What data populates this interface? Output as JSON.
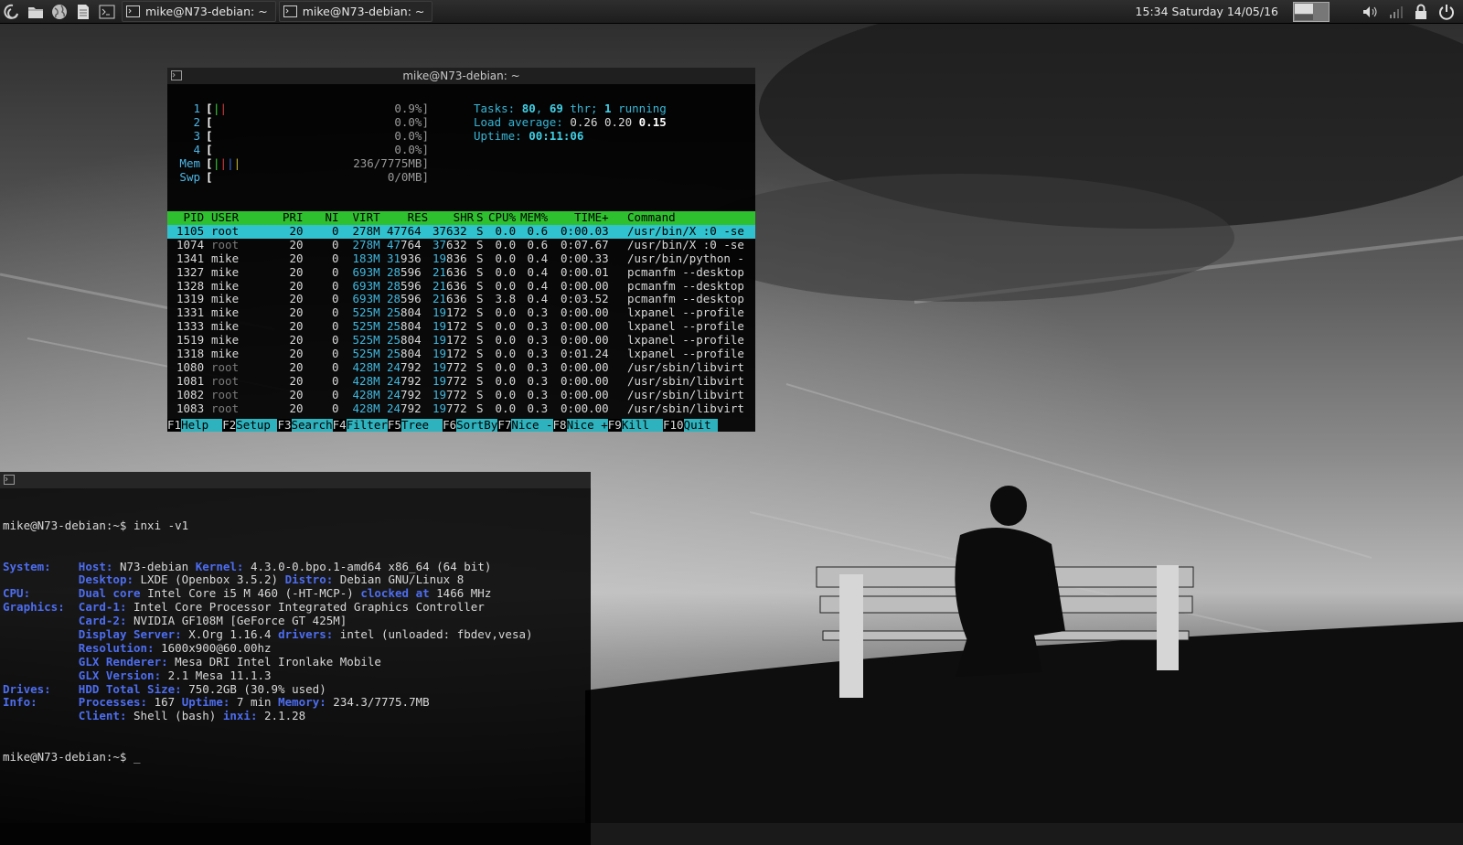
{
  "panel": {
    "tasks": [
      {
        "title": "mike@N73-debian: ~"
      },
      {
        "title": "mike@N73-debian: ~"
      }
    ],
    "clock": "15:34 Saturday 14/05/16"
  },
  "htop": {
    "title": "mike@N73-debian: ~",
    "meters": [
      {
        "label": "1",
        "value": "0.9%]",
        "bars": "||"
      },
      {
        "label": "2",
        "value": "0.0%]",
        "bars": ""
      },
      {
        "label": "3",
        "value": "0.0%]",
        "bars": ""
      },
      {
        "label": "4",
        "value": "0.0%]",
        "bars": ""
      },
      {
        "label": "Mem",
        "value": "236/7775MB]",
        "bars": "||||"
      },
      {
        "label": "Swp",
        "value": "0/0MB]",
        "bars": ""
      }
    ],
    "tasks": {
      "label": "Tasks:",
      "count": "80",
      "sep": ",",
      "threads": "69",
      "thr_label": "thr;",
      "running": "1",
      "running_label": "running"
    },
    "load": {
      "label": "Load average:",
      "a": "0.26",
      "b": "0.20",
      "c": "0.15"
    },
    "uptime": {
      "label": "Uptime:",
      "value": "00:11:06"
    },
    "columns": {
      "pid": "PID",
      "user": "USER",
      "pri": "PRI",
      "ni": "NI",
      "virt": "VIRT",
      "res": "RES",
      "shr": "SHR",
      "s": "S",
      "cpu": "CPU%",
      "mem": "MEM%",
      "time": "TIME+",
      "cmd": "Command"
    },
    "rows": [
      {
        "pid": "1105",
        "user": "root",
        "pri": "20",
        "ni": "0",
        "virt": "278M",
        "res_k": "47",
        "res": "764",
        "shr_k": "37",
        "shr": "632",
        "s": "S",
        "cpu": "0.0",
        "mem": "0.6",
        "time": "0:00.03",
        "cmd": "/usr/bin/X :0 -se"
      },
      {
        "pid": "1074",
        "user": "root",
        "pri": "20",
        "ni": "0",
        "virt": "278M",
        "res_k": "47",
        "res": "764",
        "shr_k": "37",
        "shr": "632",
        "s": "S",
        "cpu": "0.0",
        "mem": "0.6",
        "time": "0:07.67",
        "cmd": "/usr/bin/X :0 -se"
      },
      {
        "pid": "1341",
        "user": "mike",
        "pri": "20",
        "ni": "0",
        "virt": "183M",
        "res_k": "31",
        "res": "936",
        "shr_k": "19",
        "shr": "836",
        "s": "S",
        "cpu": "0.0",
        "mem": "0.4",
        "time": "0:00.33",
        "cmd": "/usr/bin/python -"
      },
      {
        "pid": "1327",
        "user": "mike",
        "pri": "20",
        "ni": "0",
        "virt": "693M",
        "res_k": "28",
        "res": "596",
        "shr_k": "21",
        "shr": "636",
        "s": "S",
        "cpu": "0.0",
        "mem": "0.4",
        "time": "0:00.01",
        "cmd": "pcmanfm --desktop"
      },
      {
        "pid": "1328",
        "user": "mike",
        "pri": "20",
        "ni": "0",
        "virt": "693M",
        "res_k": "28",
        "res": "596",
        "shr_k": "21",
        "shr": "636",
        "s": "S",
        "cpu": "0.0",
        "mem": "0.4",
        "time": "0:00.00",
        "cmd": "pcmanfm --desktop"
      },
      {
        "pid": "1319",
        "user": "mike",
        "pri": "20",
        "ni": "0",
        "virt": "693M",
        "res_k": "28",
        "res": "596",
        "shr_k": "21",
        "shr": "636",
        "s": "S",
        "cpu": "3.8",
        "mem": "0.4",
        "time": "0:03.52",
        "cmd": "pcmanfm --desktop"
      },
      {
        "pid": "1331",
        "user": "mike",
        "pri": "20",
        "ni": "0",
        "virt": "525M",
        "res_k": "25",
        "res": "804",
        "shr_k": "19",
        "shr": "172",
        "s": "S",
        "cpu": "0.0",
        "mem": "0.3",
        "time": "0:00.00",
        "cmd": "lxpanel --profile"
      },
      {
        "pid": "1333",
        "user": "mike",
        "pri": "20",
        "ni": "0",
        "virt": "525M",
        "res_k": "25",
        "res": "804",
        "shr_k": "19",
        "shr": "172",
        "s": "S",
        "cpu": "0.0",
        "mem": "0.3",
        "time": "0:00.00",
        "cmd": "lxpanel --profile"
      },
      {
        "pid": "1519",
        "user": "mike",
        "pri": "20",
        "ni": "0",
        "virt": "525M",
        "res_k": "25",
        "res": "804",
        "shr_k": "19",
        "shr": "172",
        "s": "S",
        "cpu": "0.0",
        "mem": "0.3",
        "time": "0:00.00",
        "cmd": "lxpanel --profile"
      },
      {
        "pid": "1318",
        "user": "mike",
        "pri": "20",
        "ni": "0",
        "virt": "525M",
        "res_k": "25",
        "res": "804",
        "shr_k": "19",
        "shr": "172",
        "s": "S",
        "cpu": "0.0",
        "mem": "0.3",
        "time": "0:01.24",
        "cmd": "lxpanel --profile"
      },
      {
        "pid": "1080",
        "user": "root",
        "pri": "20",
        "ni": "0",
        "virt": "428M",
        "res_k": "24",
        "res": "792",
        "shr_k": "19",
        "shr": "772",
        "s": "S",
        "cpu": "0.0",
        "mem": "0.3",
        "time": "0:00.00",
        "cmd": "/usr/sbin/libvirt"
      },
      {
        "pid": "1081",
        "user": "root",
        "pri": "20",
        "ni": "0",
        "virt": "428M",
        "res_k": "24",
        "res": "792",
        "shr_k": "19",
        "shr": "772",
        "s": "S",
        "cpu": "0.0",
        "mem": "0.3",
        "time": "0:00.00",
        "cmd": "/usr/sbin/libvirt"
      },
      {
        "pid": "1082",
        "user": "root",
        "pri": "20",
        "ni": "0",
        "virt": "428M",
        "res_k": "24",
        "res": "792",
        "shr_k": "19",
        "shr": "772",
        "s": "S",
        "cpu": "0.0",
        "mem": "0.3",
        "time": "0:00.00",
        "cmd": "/usr/sbin/libvirt"
      },
      {
        "pid": "1083",
        "user": "root",
        "pri": "20",
        "ni": "0",
        "virt": "428M",
        "res_k": "24",
        "res": "792",
        "shr_k": "19",
        "shr": "772",
        "s": "S",
        "cpu": "0.0",
        "mem": "0.3",
        "time": "0:00.00",
        "cmd": "/usr/sbin/libvirt"
      }
    ],
    "fkeys": [
      {
        "key": "F1",
        "label": "Help  "
      },
      {
        "key": "F2",
        "label": "Setup "
      },
      {
        "key": "F3",
        "label": "Search"
      },
      {
        "key": "F4",
        "label": "Filter"
      },
      {
        "key": "F5",
        "label": "Tree  "
      },
      {
        "key": "F6",
        "label": "SortBy"
      },
      {
        "key": "F7",
        "label": "Nice -"
      },
      {
        "key": "F8",
        "label": "Nice +"
      },
      {
        "key": "F9",
        "label": "Kill  "
      },
      {
        "key": "F10",
        "label": "Quit "
      }
    ]
  },
  "inxi": {
    "prompt1": "mike@N73-debian:~$ inxi -v1",
    "prompt2": "mike@N73-debian:~$ _",
    "lines": [
      [
        {
          "k": "System:    "
        },
        {
          "k": "Host: "
        },
        {
          "v": "N73-debian "
        },
        {
          "k": "Kernel: "
        },
        {
          "v": "4.3.0-0.bpo.1-amd64 x86_64 (64 bit)"
        }
      ],
      [
        {
          "v": "           "
        },
        {
          "k": "Desktop: "
        },
        {
          "v": "LXDE (Openbox 3.5.2) "
        },
        {
          "k": "Distro: "
        },
        {
          "v": "Debian GNU/Linux 8"
        }
      ],
      [
        {
          "k": "CPU:       "
        },
        {
          "k": "Dual core "
        },
        {
          "v": "Intel Core i5 M 460 (-HT-MCP-) "
        },
        {
          "k": "clocked at "
        },
        {
          "v": "1466 MHz"
        }
      ],
      [
        {
          "k": "Graphics:  "
        },
        {
          "k": "Card-1: "
        },
        {
          "v": "Intel Core Processor Integrated Graphics Controller"
        }
      ],
      [
        {
          "v": "           "
        },
        {
          "k": "Card-2: "
        },
        {
          "v": "NVIDIA GF108M [GeForce GT 425M]"
        }
      ],
      [
        {
          "v": "           "
        },
        {
          "k": "Display Server: "
        },
        {
          "v": "X.Org 1.16.4 "
        },
        {
          "k": "drivers: "
        },
        {
          "v": "intel (unloaded: fbdev,vesa)"
        }
      ],
      [
        {
          "v": "           "
        },
        {
          "k": "Resolution: "
        },
        {
          "v": "1600x900@60.00hz"
        }
      ],
      [
        {
          "v": "           "
        },
        {
          "k": "GLX Renderer: "
        },
        {
          "v": "Mesa DRI Intel Ironlake Mobile"
        }
      ],
      [
        {
          "v": "           "
        },
        {
          "k": "GLX Version: "
        },
        {
          "v": "2.1 Mesa 11.1.3"
        }
      ],
      [
        {
          "k": "Drives:    "
        },
        {
          "k": "HDD Total Size: "
        },
        {
          "v": "750.2GB (30.9% used)"
        }
      ],
      [
        {
          "k": "Info:      "
        },
        {
          "k": "Processes: "
        },
        {
          "v": "167 "
        },
        {
          "k": "Uptime: "
        },
        {
          "v": "7 min "
        },
        {
          "k": "Memory: "
        },
        {
          "v": "234.3/7775.7MB"
        }
      ],
      [
        {
          "v": "           "
        },
        {
          "k": "Client: "
        },
        {
          "v": "Shell (bash) "
        },
        {
          "k": "inxi: "
        },
        {
          "v": "2.1.28"
        }
      ]
    ]
  },
  "colors": {
    "htop_header": "#2fc02f",
    "htop_selected": "#31c2cf",
    "inxi_key": "#4d6df0"
  }
}
